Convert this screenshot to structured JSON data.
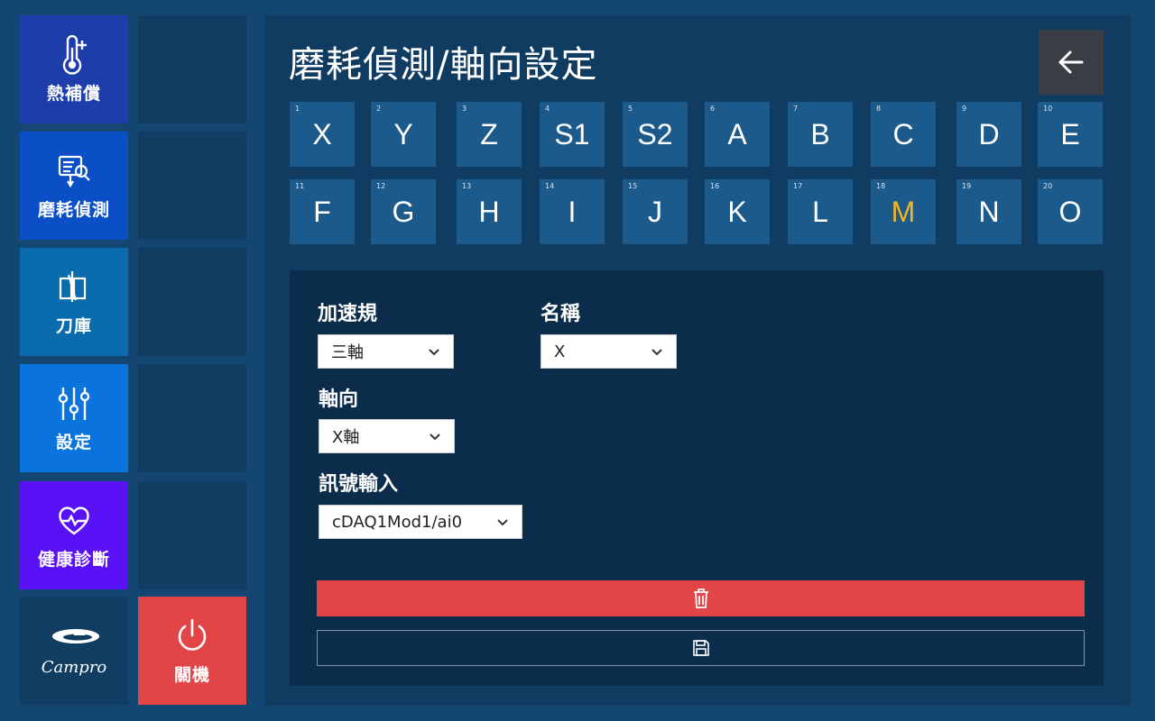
{
  "sidebar": {
    "items": [
      {
        "label": "熱補償",
        "icon": "thermometer-plus-icon",
        "color": "#1d3dab"
      },
      {
        "label": "磨耗偵測",
        "icon": "tool-wear-search-icon",
        "color": "#0b4fc6"
      },
      {
        "label": "刀庫",
        "icon": "tool-magazine-icon",
        "color": "#0b6cad"
      },
      {
        "label": "設定",
        "icon": "sliders-icon",
        "color": "#0a73de"
      },
      {
        "label": "健康診斷",
        "icon": "heart-pulse-icon",
        "color": "#5911f5"
      }
    ],
    "logo": "Campro",
    "power_label": "關機",
    "power_color": "#e24548"
  },
  "header": {
    "title": "磨耗偵測/軸向設定"
  },
  "axes": [
    {
      "num": "1",
      "label": "X"
    },
    {
      "num": "2",
      "label": "Y"
    },
    {
      "num": "3",
      "label": "Z"
    },
    {
      "num": "4",
      "label": "S1"
    },
    {
      "num": "5",
      "label": "S2"
    },
    {
      "num": "6",
      "label": "A"
    },
    {
      "num": "7",
      "label": "B"
    },
    {
      "num": "8",
      "label": "C"
    },
    {
      "num": "9",
      "label": "D"
    },
    {
      "num": "10",
      "label": "E"
    },
    {
      "num": "11",
      "label": "F"
    },
    {
      "num": "12",
      "label": "G"
    },
    {
      "num": "13",
      "label": "H"
    },
    {
      "num": "14",
      "label": "I"
    },
    {
      "num": "15",
      "label": "J"
    },
    {
      "num": "16",
      "label": "K"
    },
    {
      "num": "17",
      "label": "L"
    },
    {
      "num": "18",
      "label": "M"
    },
    {
      "num": "19",
      "label": "N"
    },
    {
      "num": "20",
      "label": "O"
    }
  ],
  "active_axis": "M",
  "accent_color": "#f2b620",
  "form": {
    "accelerometer_label": "加速規",
    "accelerometer_value": "三軸",
    "name_label": "名稱",
    "name_value": "X",
    "direction_label": "軸向",
    "direction_value": "X軸",
    "signal_label": "訊號輸入",
    "signal_value": "cDAQ1Mod1/ai0"
  },
  "actions": {
    "delete_icon": "trash-icon",
    "save_icon": "save-icon"
  }
}
